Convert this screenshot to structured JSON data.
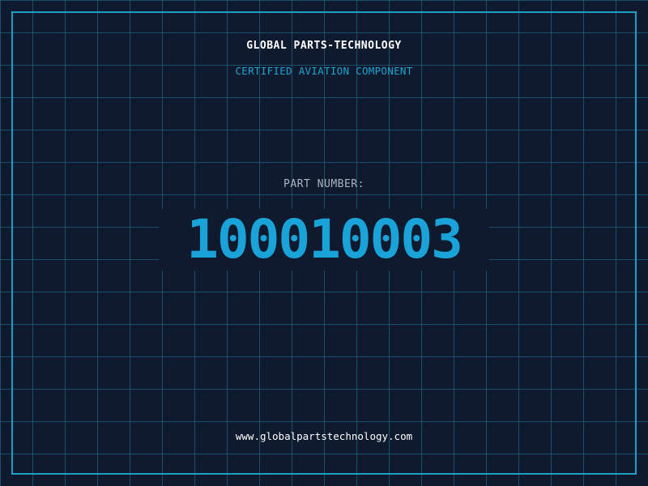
{
  "header": {
    "brand": "GLOBAL PARTS-TECHNOLOGY",
    "subtitle": "CERTIFIED AVIATION COMPONENT"
  },
  "part": {
    "label": "PART NUMBER:",
    "number": "100010003"
  },
  "footer": {
    "url": "www.globalpartstechnology.com"
  },
  "colors": {
    "background": "#101a2e",
    "grid": "#28789a",
    "frame": "#1e9fc7",
    "accent": "#1aa3d8",
    "label": "#a9b6c6",
    "text": "#ffffff"
  }
}
